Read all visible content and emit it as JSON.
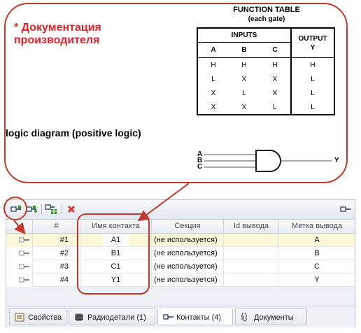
{
  "callout": {
    "title": "* Документация производителя"
  },
  "function_table": {
    "title": "FUNCTION TABLE",
    "subtitle": "(each gate)",
    "inputs_label": "INPUTS",
    "output_label": "OUTPUT",
    "columns": [
      "A",
      "B",
      "C",
      "Y"
    ],
    "rows": [
      [
        "H",
        "H",
        "H",
        "H"
      ],
      [
        "L",
        "X",
        "X",
        "L"
      ],
      [
        "X",
        "L",
        "X",
        "L"
      ],
      [
        "X",
        "X",
        "L",
        "L"
      ]
    ]
  },
  "logic_diagram": {
    "title": "logic diagram (positive logic)",
    "inputs": [
      "A",
      "B",
      "C"
    ],
    "output": "Y"
  },
  "grid": {
    "headers": [
      "#",
      "Имя контакта",
      "Секция",
      "Id вывода",
      "Метка вывода"
    ],
    "rows": [
      {
        "num": "#1",
        "name": "A1",
        "section": "(не используется)",
        "pin_id": "",
        "label": "A"
      },
      {
        "num": "#2",
        "name": "B1",
        "section": "(не используется)",
        "pin_id": "",
        "label": "B"
      },
      {
        "num": "#3",
        "name": "C1",
        "section": "(не используется)",
        "pin_id": "",
        "label": "C"
      },
      {
        "num": "#4",
        "name": "Y1",
        "section": "(не используется)",
        "pin_id": "",
        "label": "Y"
      }
    ]
  },
  "tabs": [
    {
      "label": "Свойства",
      "icon": "properties-icon"
    },
    {
      "label": "Радиодетали (1)",
      "icon": "chip-icon"
    },
    {
      "label": "Контакты (4)",
      "icon": "pin-icon"
    },
    {
      "label": "Документы",
      "icon": "paperclip-icon"
    }
  ],
  "colors": {
    "annotation_red": "#c0392b",
    "title_red": "#e5232a",
    "selected_row": "#fdf7d9"
  }
}
